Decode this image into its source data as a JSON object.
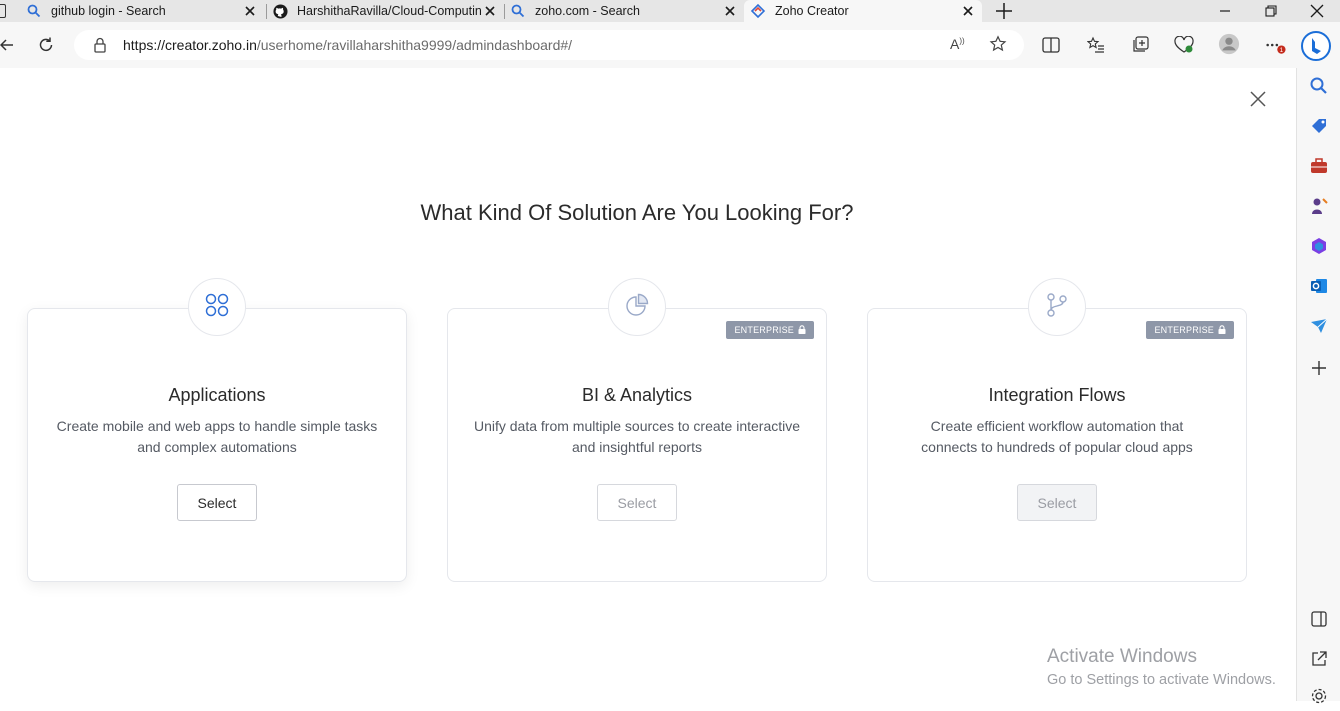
{
  "browser": {
    "tabs": [
      {
        "title": "github login - Search",
        "icon": "search-icon",
        "active": false
      },
      {
        "title": "HarshithaRavilla/Cloud-Computing",
        "icon": "github-icon",
        "active": false
      },
      {
        "title": "zoho.com - Search",
        "icon": "search-icon",
        "active": false
      },
      {
        "title": "Zoho Creator",
        "icon": "zoho-creator-icon",
        "active": true
      }
    ],
    "url_host": "https://creator.zoho.in",
    "url_path": "/userhome/ravillaharshitha9999/admindashboard#/"
  },
  "page": {
    "heading": "What Kind Of Solution Are You Looking For?",
    "cards": [
      {
        "title": "Applications",
        "description_line1": "Create mobile and web apps to handle simple tasks",
        "description_line2": "and complex automations",
        "button": "Select",
        "icon": "apps-grid-icon",
        "badge": null,
        "enabled": true
      },
      {
        "title": "BI & Analytics",
        "description_line1": "Unify data from multiple sources to create interactive",
        "description_line2": "and insightful reports",
        "button": "Select",
        "icon": "pie-chart-icon",
        "badge": "ENTERPRISE",
        "enabled": false
      },
      {
        "title": "Integration Flows",
        "description_line1": "Create efficient workflow automation that",
        "description_line2": "connects to hundreds of popular cloud apps",
        "button": "Select",
        "icon": "flow-branch-icon",
        "badge": "ENTERPRISE",
        "enabled": false
      }
    ]
  },
  "watermark": {
    "line1": "Activate Windows",
    "line2": "Go to Settings to activate Windows."
  },
  "colors": {
    "accent_blue": "#2f6fd6",
    "badge_grey": "#8e97a8",
    "text_dark": "#2b2b2b"
  }
}
